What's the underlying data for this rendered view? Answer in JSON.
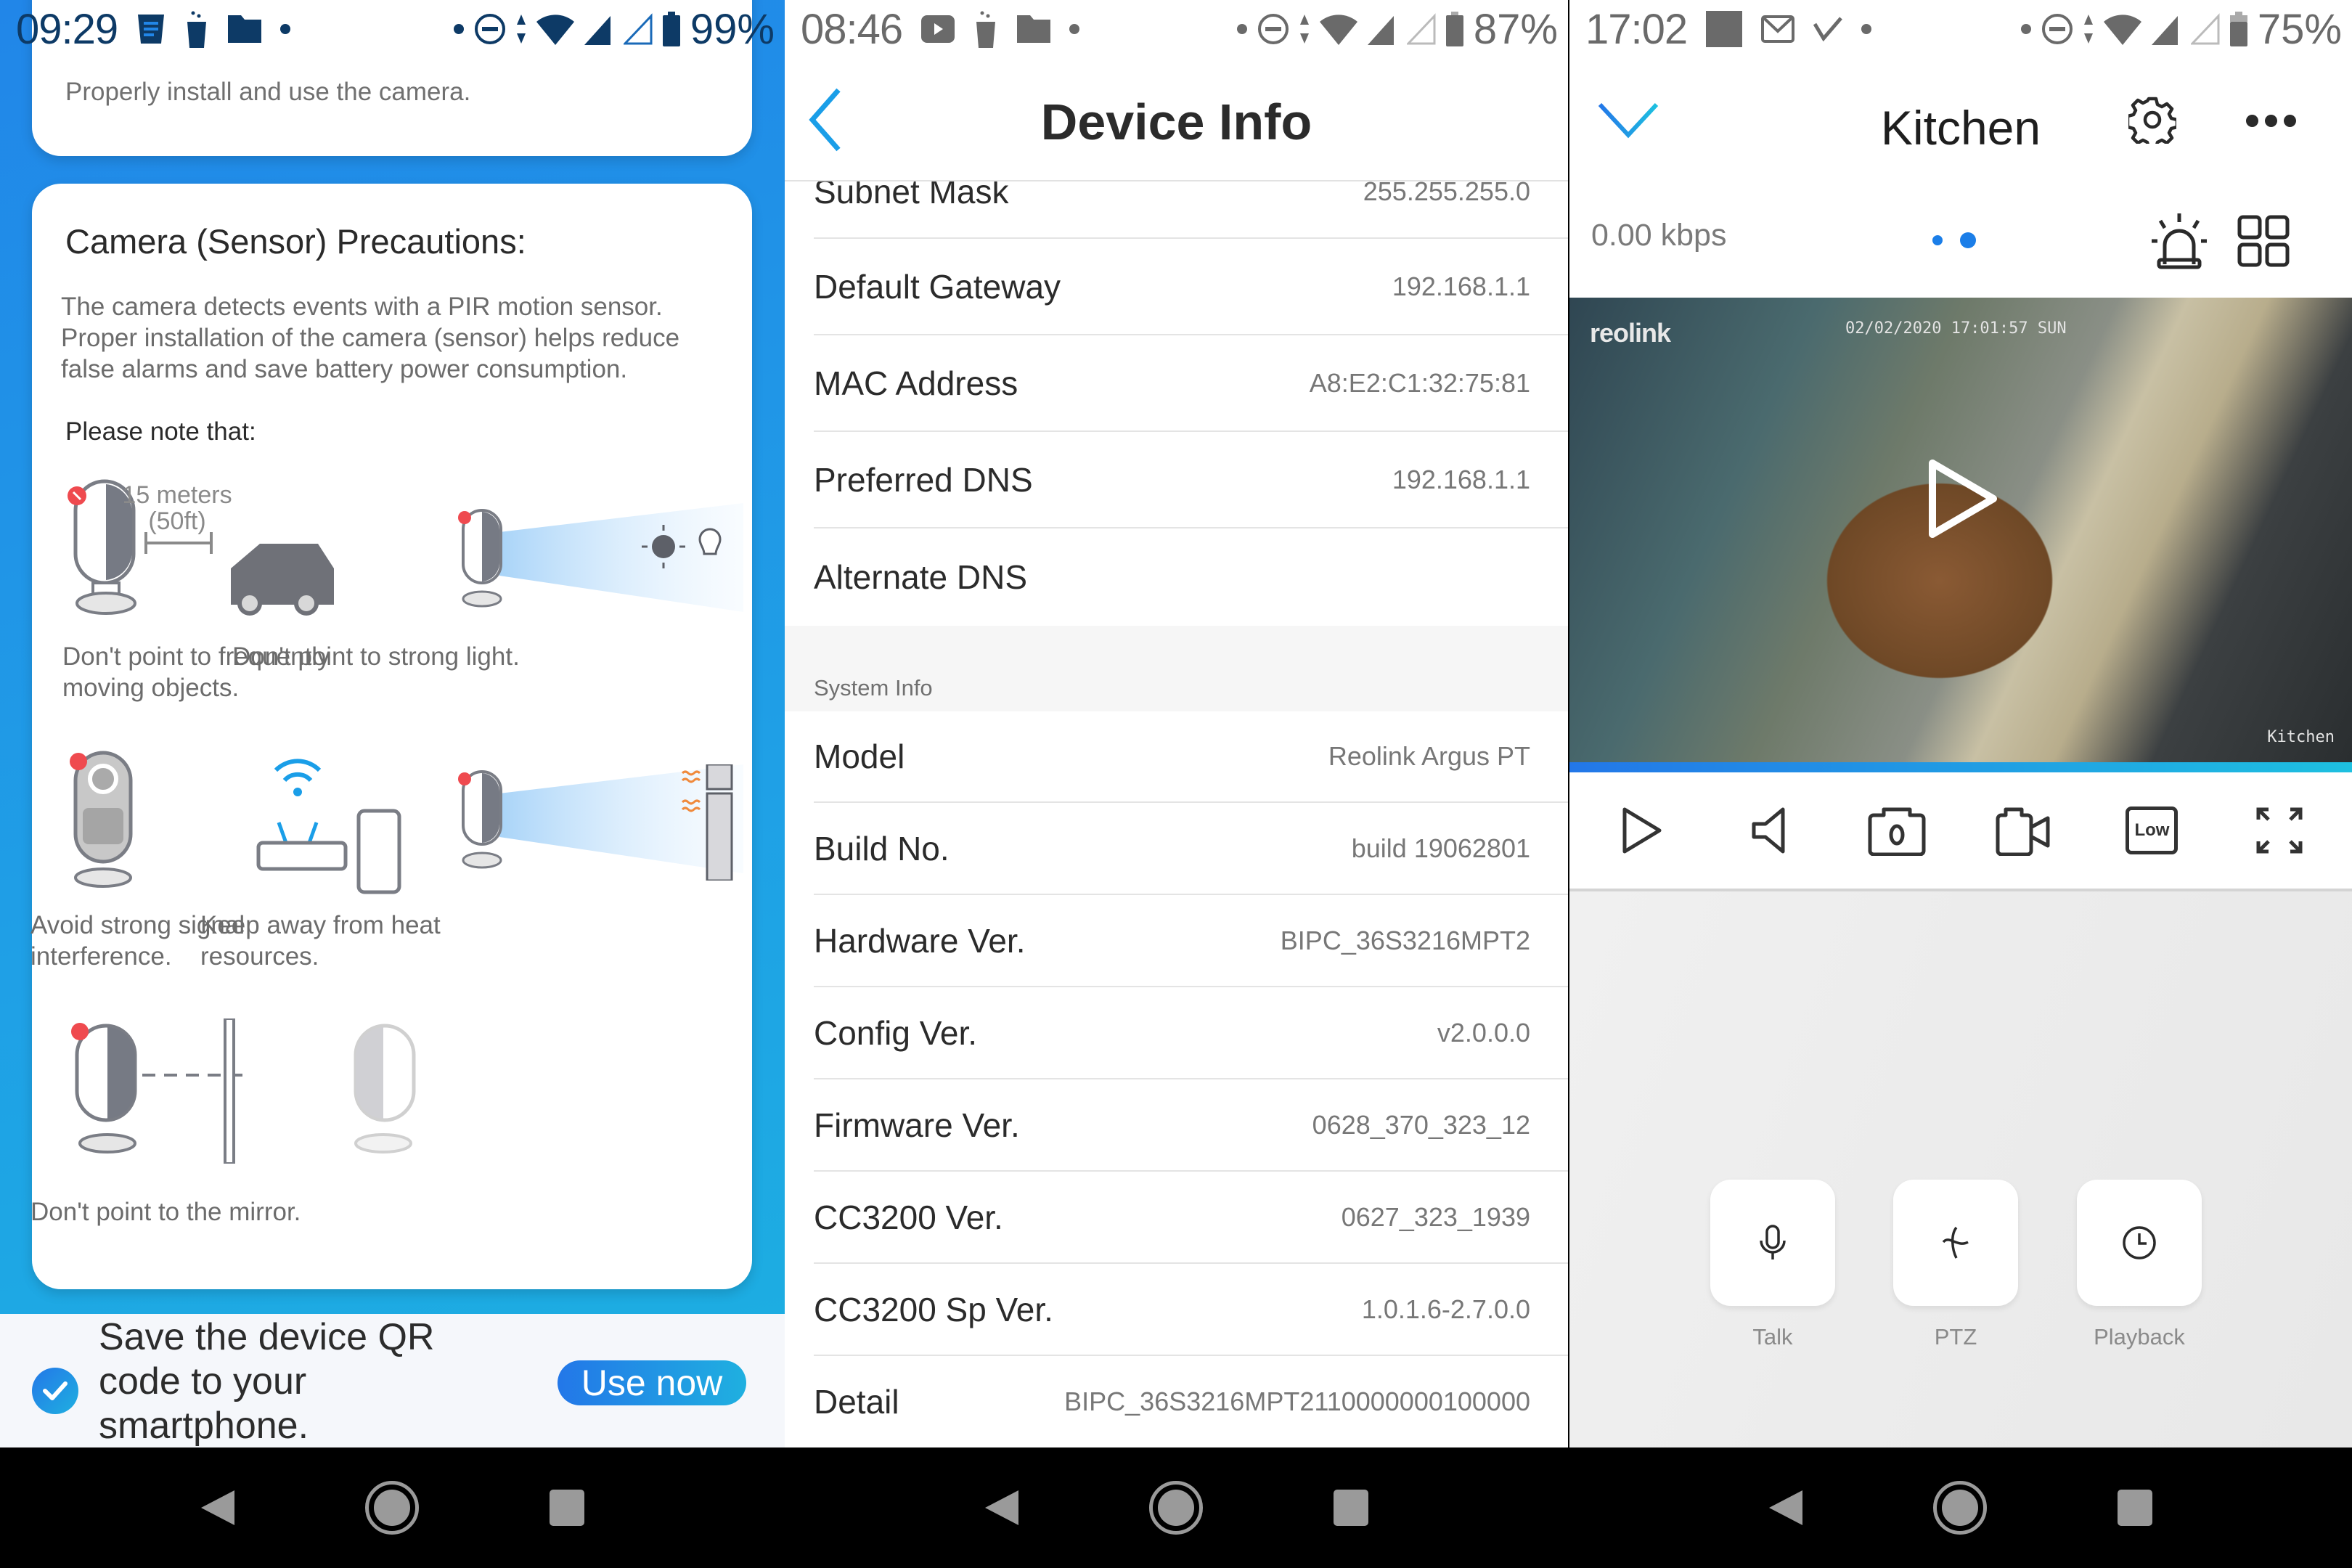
{
  "panel1": {
    "status_bar": {
      "time": "09:29",
      "battery": "99%",
      "icons": [
        "notes-icon",
        "cup-icon",
        "folder-icon",
        "dot",
        "dot",
        "dnd-icon",
        "data-arrows-icon",
        "wifi-icon",
        "signal-x-icon",
        "signal-empty-icon",
        "battery-icon"
      ]
    },
    "intro_card": {
      "text": "Properly install and use the camera."
    },
    "precautions_card": {
      "title": "Camera (Sensor) Precautions:",
      "body": "The camera detects events with a PIR motion sensor. Proper installation of the camera (sensor) helps reduce false alarms and save battery power consumption.",
      "note": "Please note that:",
      "distance_label_1": "15 meters",
      "distance_label_2": "(50ft)",
      "items": [
        {
          "caption": "Don't point to frequently moving objects.",
          "illustration": "camera-and-car-illustration"
        },
        {
          "caption": "Don't point to strong light.",
          "illustration": "camera-and-light-illustration"
        },
        {
          "caption": "Avoid strong signal interference.",
          "illustration": "camera-and-router-illustration"
        },
        {
          "caption": "Keep away from heat resources.",
          "illustration": "camera-and-heater-illustration"
        },
        {
          "caption": "Don't point to the mirror.",
          "illustration": "camera-and-mirror-illustration"
        }
      ]
    },
    "save_bar": {
      "checked": true,
      "text": "Save the device QR code to your smartphone.",
      "button": "Use now"
    }
  },
  "panel2": {
    "status_bar": {
      "time": "08:46",
      "battery": "87%"
    },
    "header": {
      "title": "Device Info",
      "back_icon": "chevron-left-icon"
    },
    "network_rows": [
      {
        "label": "Subnet Mask",
        "value": "255.255.255.0"
      },
      {
        "label": "Default Gateway",
        "value": "192.168.1.1"
      },
      {
        "label": "MAC Address",
        "value": "A8:E2:C1:32:75:81"
      },
      {
        "label": "Preferred DNS",
        "value": "192.168.1.1"
      },
      {
        "label": "Alternate DNS",
        "value": ""
      }
    ],
    "system_section_label": "System Info",
    "system_rows": [
      {
        "label": "Model",
        "value": "Reolink Argus PT"
      },
      {
        "label": "Build No.",
        "value": "build 19062801"
      },
      {
        "label": "Hardware Ver.",
        "value": "BIPC_36S3216MPT2"
      },
      {
        "label": "Config Ver.",
        "value": "v2.0.0.0"
      },
      {
        "label": "Firmware Ver.",
        "value": "0628_370_323_12"
      },
      {
        "label": "CC3200 Ver.",
        "value": "0627_323_1939"
      },
      {
        "label": "CC3200 Sp Ver.",
        "value": "1.0.1.6-2.7.0.0"
      },
      {
        "label": "Detail",
        "value": "BIPC_36S3216MPT2110000000100000"
      }
    ]
  },
  "panel3": {
    "status_bar": {
      "time": "17:02",
      "battery": "75%"
    },
    "header": {
      "title": "Kitchen"
    },
    "bitrate": "0.00 kbps",
    "page_indicator": {
      "count": 2,
      "active": 2
    },
    "video": {
      "brand": "reolink",
      "timestamp": "02/02/2020 17:01:57 SUN",
      "camera_name": "Kitchen",
      "state": "paused"
    },
    "toolbar": [
      {
        "name": "play",
        "label": ""
      },
      {
        "name": "speaker",
        "label": ""
      },
      {
        "name": "snapshot",
        "label": ""
      },
      {
        "name": "record",
        "label": ""
      },
      {
        "name": "quality",
        "label": "Low"
      },
      {
        "name": "fullscreen",
        "label": ""
      }
    ],
    "quick_actions": [
      {
        "name": "talk",
        "label": "Talk"
      },
      {
        "name": "ptz",
        "label": "PTZ"
      },
      {
        "name": "playback",
        "label": "Playback"
      }
    ]
  },
  "colors": {
    "accent": "#1b7ee8",
    "accent_gradient_end": "#1ec0e0",
    "text_primary": "#2b2b2b",
    "text_secondary": "#777777"
  }
}
